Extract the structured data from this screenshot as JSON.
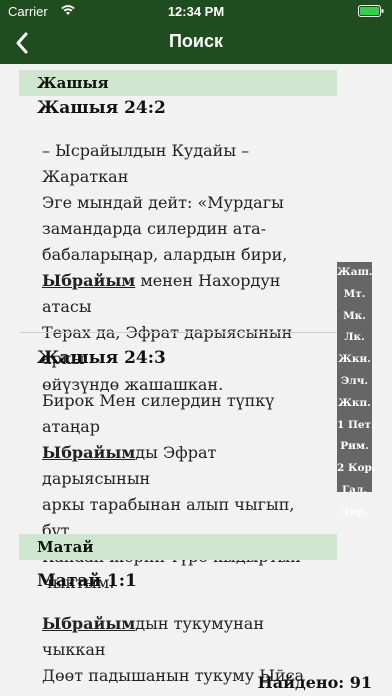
{
  "status": {
    "carrier": "Carrier",
    "time": "12:34 PM"
  },
  "nav": {
    "title": "Поиск"
  },
  "sections": [
    {
      "book": "Жашыя",
      "verses": [
        {
          "ref": "Жашыя 24:2",
          "lines": [
            [
              {
                "t": "– Ысрайылдын Кудайы – Жараткан"
              }
            ],
            [
              {
                "t": "Эге мындай дейт: «Мурдагы"
              }
            ],
            [
              {
                "t": "замандарда силердин ата-"
              }
            ],
            [
              {
                "t": "бабаларыңар, алардын бири,"
              }
            ],
            [
              {
                "t": "Ыбрайым",
                "hl": true
              },
              {
                "t": " менен Нахордун атасы"
              }
            ],
            [
              {
                "t": "Терах да, Эфрат дарыясынын аркы"
              }
            ],
            [
              {
                "t": "өйүзүндө жашашкан."
              }
            ]
          ]
        },
        {
          "ref": "Жашыя 24:3",
          "lines": [
            [
              {
                "t": "Бирок Мен силердин түпкү атаңар"
              }
            ],
            [
              {
                "t": "Ыбрайым",
                "hl": true
              },
              {
                "t": "ды Эфрат дарыясынын"
              }
            ],
            [
              {
                "t": "аркы тарабынан алып чыгып, бүт"
              }
            ],
            [
              {
                "t": "Канаан жерин түрө кыдыртып"
              }
            ],
            [
              {
                "t": "чыктым."
              }
            ]
          ]
        }
      ]
    },
    {
      "book": "Матай",
      "verses": [
        {
          "ref": "Матай 1:1",
          "lines": [
            [
              {
                "t": "Ыбрайым",
                "hl": true
              },
              {
                "t": "дын тукумунан чыккан"
              }
            ],
            [
              {
                "t": "Дөөт падышанын тукуму Ыйса"
              }
            ]
          ]
        }
      ]
    }
  ],
  "index": [
    "Жаш.",
    "Мт.",
    "Мк.",
    "Лк.",
    "Жкн.",
    "Элч.",
    "Жкп.",
    "1 Пет.",
    "Рим.",
    "2 Кор.",
    "Гал.",
    "Эвр."
  ],
  "found": "Найдено: 91"
}
